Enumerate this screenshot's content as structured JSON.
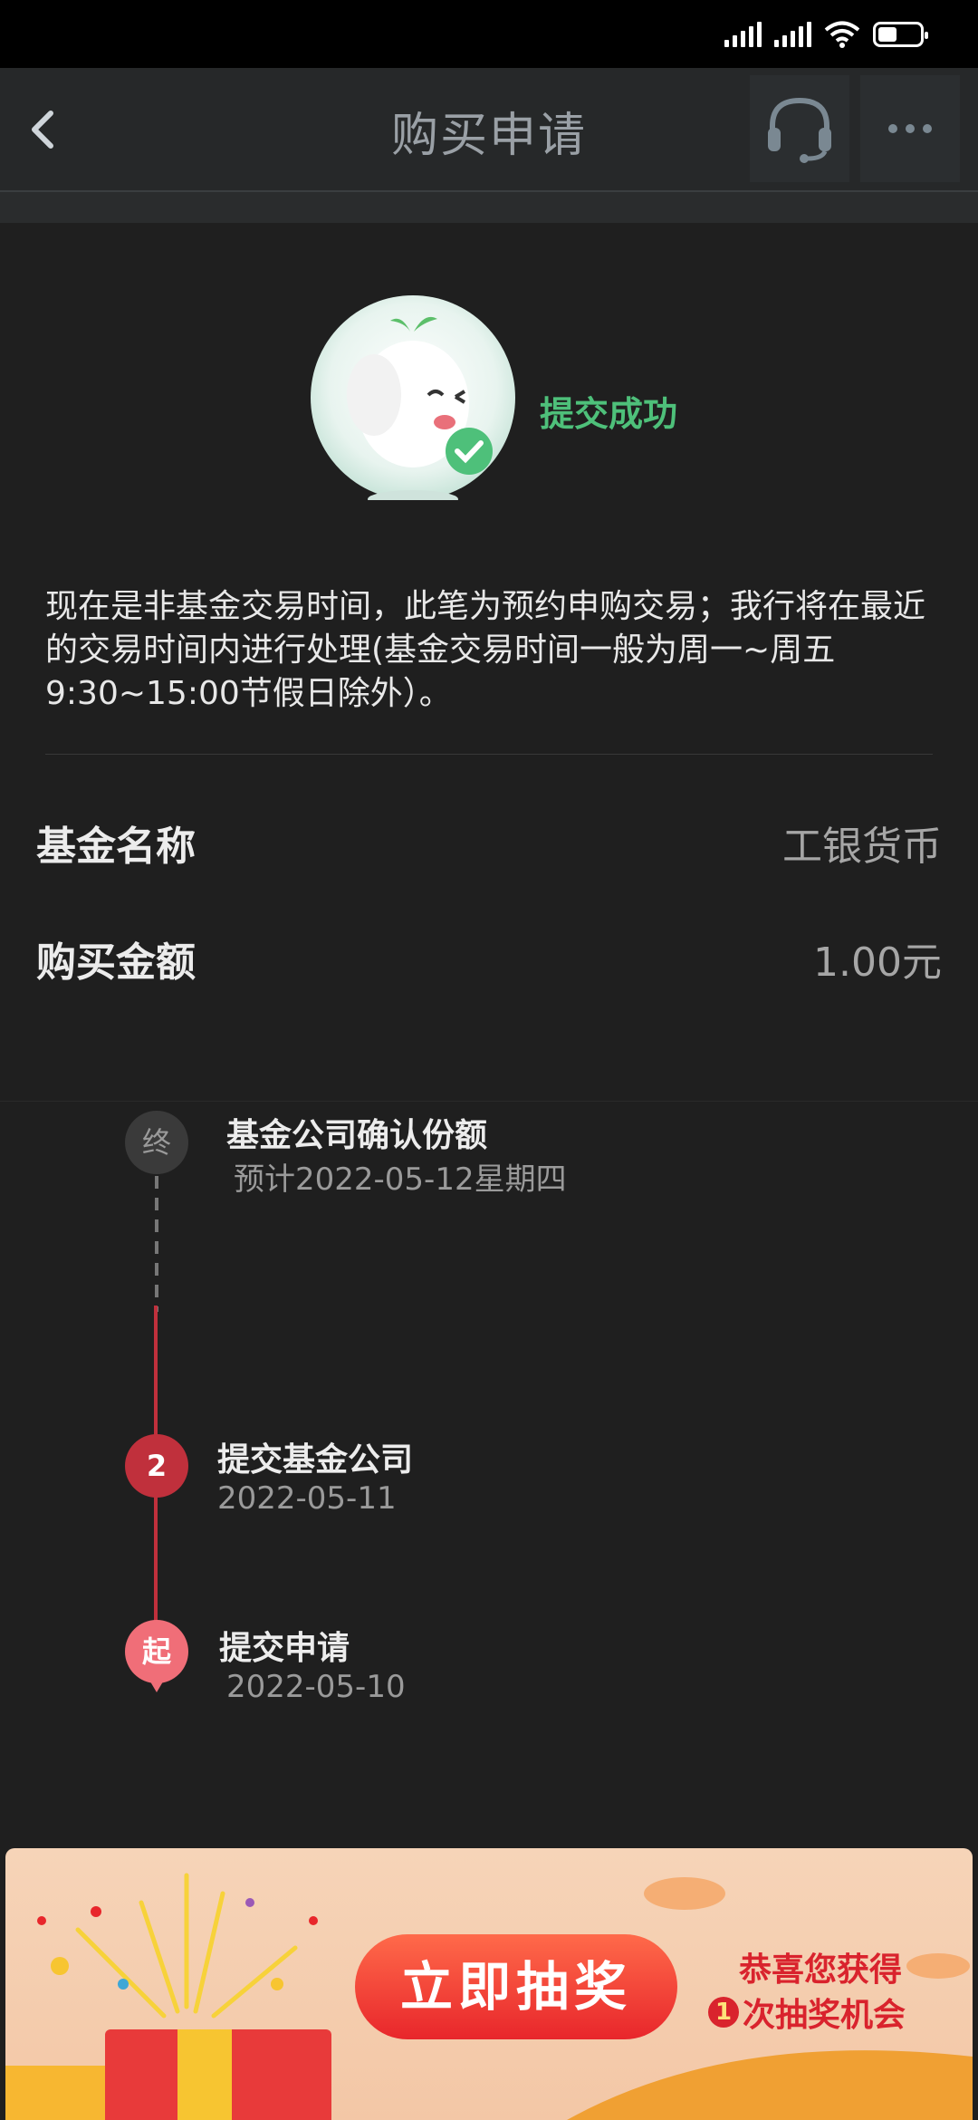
{
  "header": {
    "title": "购买申请"
  },
  "success": {
    "message": "提交成功",
    "notice": "现在是非基金交易时间，此笔为预约申购交易；我行将在最近的交易时间内进行处理(基金交易时间一般为周一~周五9:30~15:00节假日除外）。"
  },
  "info": {
    "fund_name_label": "基金名称",
    "fund_name_value": "工银货币",
    "amount_label": "购买金额",
    "amount_value": "1.00元"
  },
  "timeline": {
    "end": {
      "badge": "终",
      "title": "基金公司确认份额",
      "date": "预计2022-05-12星期四"
    },
    "step2": {
      "badge": "2",
      "title": "提交基金公司",
      "date": "2022-05-11"
    },
    "start": {
      "badge": "起",
      "title": "提交申请",
      "date": "2022-05-10"
    }
  },
  "banner": {
    "button_label": "立即抽奖",
    "congrats": "恭喜您获得",
    "chance_count": "1",
    "chance_text": "次抽奖机会"
  },
  "colors": {
    "success_green": "#4ec07a",
    "timeline_red": "#c0303c",
    "banner_red": "#d9232d"
  },
  "icons": [
    "back-arrow-icon",
    "headset-icon",
    "more-dots-icon",
    "check-icon",
    "signal-icon",
    "wifi-icon",
    "battery-icon"
  ]
}
